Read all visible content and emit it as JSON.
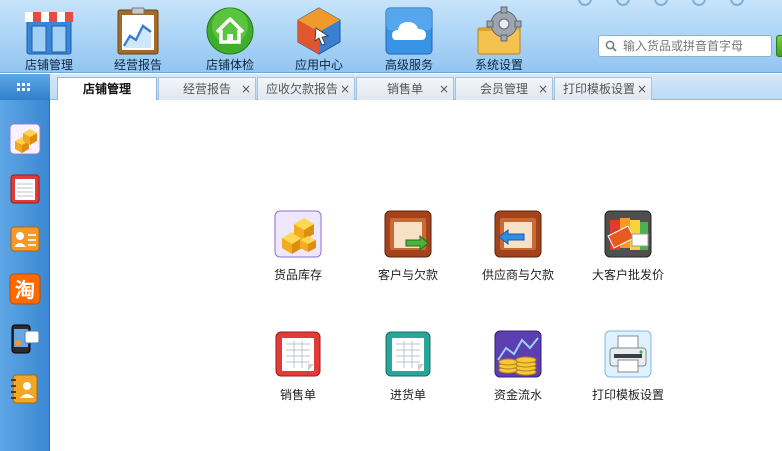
{
  "toolbar": {
    "items": [
      {
        "label": "店铺管理"
      },
      {
        "label": "经营报告"
      },
      {
        "label": "店铺体检"
      },
      {
        "label": "应用中心"
      },
      {
        "label": "高级服务"
      },
      {
        "label": "系统设置"
      }
    ],
    "search_placeholder": "输入货品或拼音首字母"
  },
  "tabs": [
    {
      "label": "店铺管理",
      "active": true
    },
    {
      "label": "经营报告",
      "close": "×"
    },
    {
      "label": "应收欠款报告",
      "close": "×"
    },
    {
      "label": "销售单",
      "close": "×"
    },
    {
      "label": "会员管理",
      "close": "×"
    },
    {
      "label": "打印模板设置",
      "close": "×"
    }
  ],
  "sidebar": {
    "items": [
      "boxes-icon",
      "notepad-icon",
      "vip-card-icon",
      "taobao-icon",
      "phone-icon",
      "address-book-icon"
    ]
  },
  "main": {
    "tiles": [
      {
        "label": "货品库存",
        "icon": "inventory-icon"
      },
      {
        "label": "客户与欠款",
        "icon": "customer-debt-icon"
      },
      {
        "label": "供应商与欠款",
        "icon": "supplier-debt-icon"
      },
      {
        "label": "大客户批发价",
        "icon": "price-tag-icon"
      },
      {
        "label": "销售单",
        "icon": "sales-order-icon"
      },
      {
        "label": "进货单",
        "icon": "purchase-order-icon"
      },
      {
        "label": "资金流水",
        "icon": "cash-flow-icon"
      },
      {
        "label": "打印模板设置",
        "icon": "printer-icon"
      }
    ]
  },
  "colors": {
    "accent": "#3b88d2",
    "toolbar_bg": "#a9d3f6"
  }
}
